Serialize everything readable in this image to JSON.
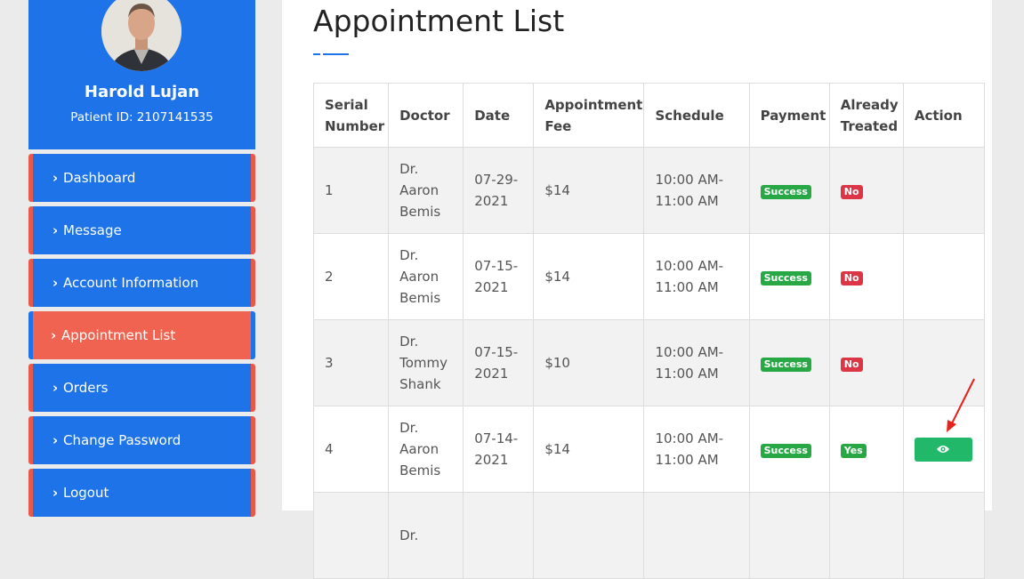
{
  "profile": {
    "name": "Harold Lujan",
    "patient_id": "Patient ID: 2107141535"
  },
  "nav": [
    {
      "label": "Dashboard"
    },
    {
      "label": "Message"
    },
    {
      "label": "Account Information"
    },
    {
      "label": "Appointment List"
    },
    {
      "label": "Orders"
    },
    {
      "label": "Change Password"
    },
    {
      "label": "Logout"
    }
  ],
  "page": {
    "title": "Appointment List"
  },
  "table": {
    "headers": {
      "serial_1": "Serial",
      "serial_2": "Number",
      "doctor": "Doctor",
      "date": "Date",
      "fee_1": "Appointment",
      "fee_2": "Fee",
      "schedule": "Schedule",
      "payment": "Payment",
      "treated_1": "Already",
      "treated_2": "Treated",
      "action": "Action"
    },
    "rows": [
      {
        "serial": "1",
        "doctor_1": "Dr.",
        "doctor_2": "Aaron",
        "doctor_3": "Bemis",
        "date_1": "07-29-",
        "date_2": "2021",
        "fee": "$14",
        "sched_1": "10:00 AM-",
        "sched_2": "11:00 AM",
        "payment": "Success",
        "treated": "No"
      },
      {
        "serial": "2",
        "doctor_1": "Dr.",
        "doctor_2": "Aaron",
        "doctor_3": "Bemis",
        "date_1": "07-15-",
        "date_2": "2021",
        "fee": "$14",
        "sched_1": "10:00 AM-",
        "sched_2": "11:00 AM",
        "payment": "Success",
        "treated": "No"
      },
      {
        "serial": "3",
        "doctor_1": "Dr.",
        "doctor_2": "Tommy",
        "doctor_3": "Shank",
        "date_1": "07-15-",
        "date_2": "2021",
        "fee": "$10",
        "sched_1": "10:00 AM-",
        "sched_2": "11:00 AM",
        "payment": "Success",
        "treated": "No"
      },
      {
        "serial": "4",
        "doctor_1": "Dr.",
        "doctor_2": "Aaron",
        "doctor_3": "Bemis",
        "date_1": "07-14-",
        "date_2": "2021",
        "fee": "$14",
        "sched_1": "10:00 AM-",
        "sched_2": "11:00 AM",
        "payment": "Success",
        "treated": "Yes"
      },
      {
        "serial": "",
        "doctor_1": "Dr.",
        "doctor_2": "",
        "doctor_3": "",
        "date_1": "",
        "date_2": "",
        "fee": "",
        "sched_1": "",
        "sched_2": "",
        "payment": "",
        "treated": ""
      }
    ]
  },
  "colors": {
    "primary": "#1e73e8",
    "accent": "#ef6350",
    "success": "#28a745",
    "danger": "#dc3545",
    "view_button": "#21b869",
    "annotation_arrow": "#e8221a"
  },
  "icons": {
    "nav_chevron": "chevron-right-icon",
    "view": "eye-icon"
  }
}
